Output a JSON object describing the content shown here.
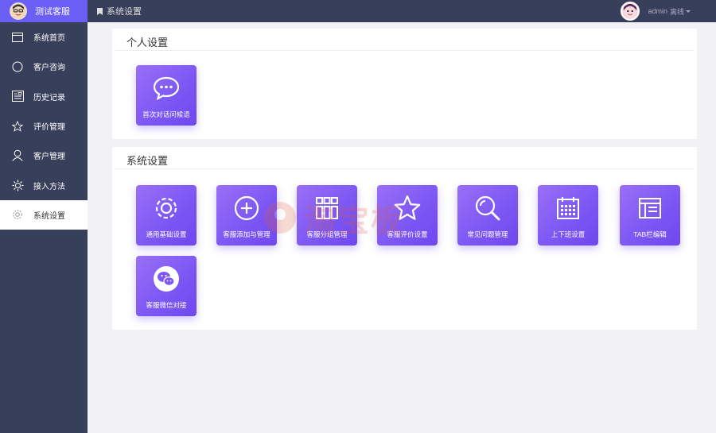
{
  "brand": {
    "name": "测试客服",
    "avatar_icon": "avatar-icon"
  },
  "sidebar": {
    "items": [
      {
        "label": "系统首页",
        "icon": "window-icon"
      },
      {
        "label": "客户咨询",
        "icon": "chat-bubble-icon"
      },
      {
        "label": "历史记录",
        "icon": "history-icon"
      },
      {
        "label": "评价管理",
        "icon": "star-icon"
      },
      {
        "label": "客户管理",
        "icon": "user-icon"
      },
      {
        "label": "接入方法",
        "icon": "puzzle-icon"
      },
      {
        "label": "系统设置",
        "icon": "gear-icon",
        "active": true
      }
    ]
  },
  "topbar": {
    "breadcrumb": "系统设置",
    "user": {
      "name": "admin",
      "status": "离线"
    }
  },
  "personal": {
    "title": "个人设置",
    "tiles": [
      {
        "label": "首次对话问候语",
        "icon": "chat-bubble-icon"
      }
    ]
  },
  "system": {
    "title": "系统设置",
    "tiles": [
      {
        "label": "通用基础设置",
        "icon": "gear-icon"
      },
      {
        "label": "客服添加与管理",
        "icon": "plus-circle-icon"
      },
      {
        "label": "客服分组管理",
        "icon": "grid-icon"
      },
      {
        "label": "客服评价设置",
        "icon": "star-icon"
      },
      {
        "label": "常见问题管理",
        "icon": "search-icon"
      },
      {
        "label": "上下班设置",
        "icon": "calendar-icon"
      },
      {
        "label": "TAB栏编辑",
        "icon": "browser-window-icon"
      },
      {
        "label": "客服微信对接",
        "icon": "wechat-icon"
      }
    ]
  },
  "watermark": {
    "text": "淘宝板"
  },
  "colors": {
    "sidebar": "#383f5a",
    "brand": "#6b5ef5",
    "tile_start": "#9a6ff6",
    "tile_end": "#6f47ef",
    "page": "#f1f1f6"
  }
}
